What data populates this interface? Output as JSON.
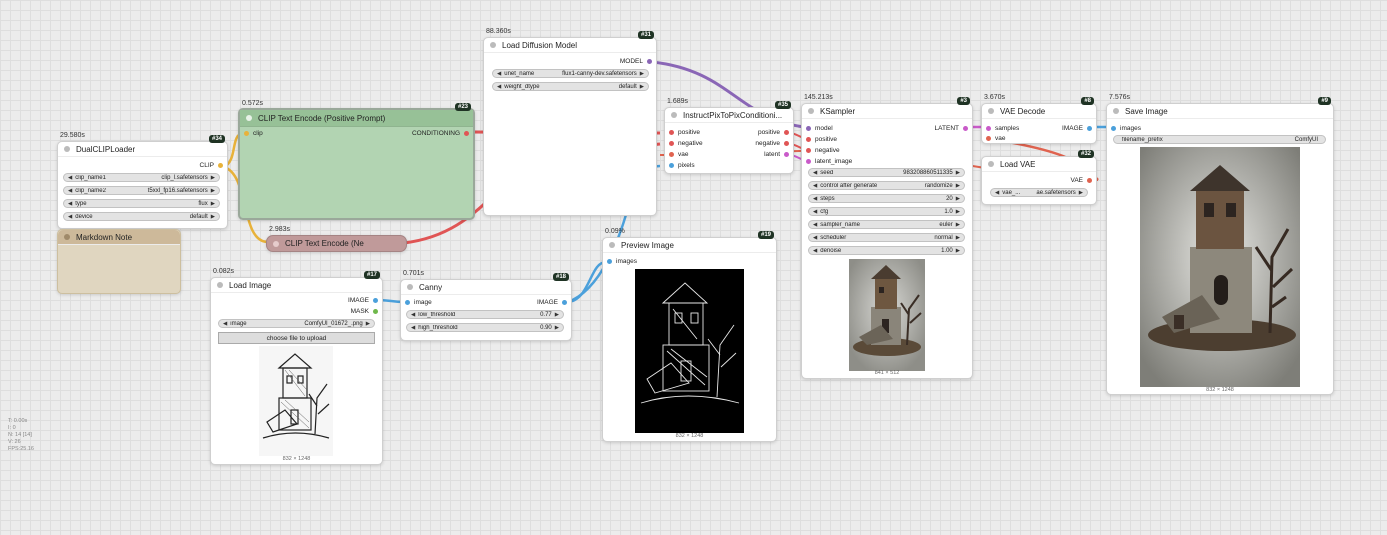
{
  "colors": {
    "clip": "#e8b23a",
    "conditioning": "#e05555",
    "model": "#8a66b6",
    "latent": "#c95ac9",
    "image": "#4ba0db",
    "vae": "#e0634f",
    "mask": "#6fb84b"
  },
  "debug": [
    "T: 0.00s",
    "I: 0",
    "N: 14 [14]",
    "V: 26",
    "FPS:25.16"
  ],
  "nodes": {
    "dualclip": {
      "time": "29.580s",
      "badge": "#34",
      "title": "DualCLIPLoader",
      "out_clip": "CLIP",
      "widgets": [
        {
          "label": "clip_name1",
          "value": "clip_l.safetensors"
        },
        {
          "label": "clip_name2",
          "value": "t5xxl_fp16.safetensors"
        },
        {
          "label": "type",
          "value": "flux"
        },
        {
          "label": "device",
          "value": "default"
        }
      ]
    },
    "markdown": {
      "title": "Markdown Note"
    },
    "clip_pos": {
      "time": "0.572s",
      "badge": "#23",
      "title": "CLIP Text Encode (Positive Prompt)",
      "in_clip": "clip",
      "out_cond": "CONDITIONING"
    },
    "clip_neg": {
      "time": "2.983s",
      "title": "CLIP Text Encode (Ne"
    },
    "load_diff": {
      "time": "88.360s",
      "badge": "#31",
      "title": "Load Diffusion Model",
      "out_model": "MODEL",
      "widgets": [
        {
          "label": "unet_name",
          "value": "flux1-canny-dev.safetensors"
        },
        {
          "label": "weight_dtype",
          "value": "default"
        }
      ]
    },
    "instruct": {
      "time": "1.689s",
      "badge": "#35",
      "title": "InstructPixToPixConditioni...",
      "inputs": [
        "positive",
        "negative",
        "vae",
        "pixels"
      ],
      "outputs": [
        "positive",
        "negative",
        "latent"
      ]
    },
    "ksampler": {
      "time": "145.213s",
      "badge": "#3",
      "title": "KSampler",
      "inputs": [
        "model",
        "positive",
        "negative",
        "latent_image"
      ],
      "out_latent": "LATENT",
      "widgets": [
        {
          "label": "seed",
          "value": "983208860511335"
        },
        {
          "label": "control after generate",
          "value": "randomize"
        },
        {
          "label": "steps",
          "value": "20"
        },
        {
          "label": "cfg",
          "value": "1.0"
        },
        {
          "label": "sampler_name",
          "value": "euler"
        },
        {
          "label": "scheduler",
          "value": "normal"
        },
        {
          "label": "denoise",
          "value": "1.00"
        }
      ],
      "caption": "841 × 512"
    },
    "vae_decode": {
      "time": "3.670s",
      "badge": "#8",
      "title": "VAE Decode",
      "in_samples": "samples",
      "in_vae": "vae",
      "out_image": "IMAGE"
    },
    "load_vae": {
      "badge": "#32",
      "title": "Load VAE",
      "out_vae": "VAE",
      "widget": {
        "label": "vae_...",
        "value": "ae.safetensors"
      }
    },
    "save_image": {
      "time": "7.576s",
      "badge": "#9",
      "title": "Save Image",
      "in_images": "images",
      "widget": {
        "label": "filename_prefix",
        "value": "ComfyUI"
      },
      "caption": "832 × 1248"
    },
    "load_image": {
      "time": "0.082s",
      "badge": "#17",
      "title": "Load Image",
      "out_image": "IMAGE",
      "out_mask": "MASK",
      "widget": {
        "label": "image",
        "value": "ComfyUI_01672_.png"
      },
      "upload": "choose file to upload",
      "caption": "832 × 1248"
    },
    "canny": {
      "time": "0.701s",
      "badge": "#18",
      "title": "Canny",
      "in_image": "image",
      "out_image": "IMAGE",
      "widgets": [
        {
          "label": "low_threshold",
          "value": "0.77"
        },
        {
          "label": "high_threshold",
          "value": "0.90"
        }
      ]
    },
    "preview": {
      "time": "0.09%",
      "badge": "#19",
      "title": "Preview Image",
      "in_images": "images",
      "caption": "832 × 1248"
    }
  }
}
